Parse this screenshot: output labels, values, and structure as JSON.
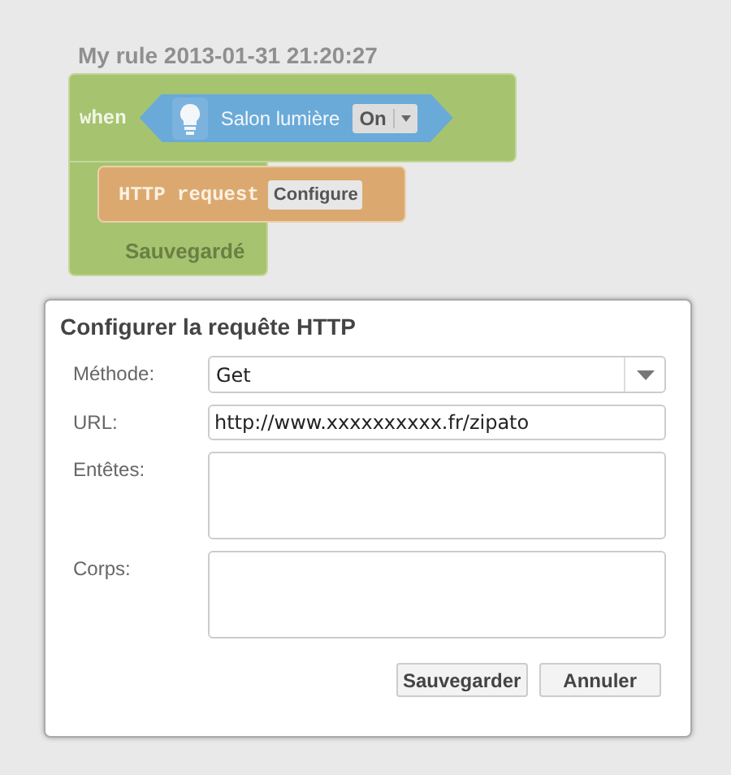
{
  "rule": {
    "title": "My rule 2013-01-31 21:20:27",
    "when_label": "when",
    "trigger": {
      "device": "Salon lumière",
      "state": "On"
    },
    "action": {
      "label": "HTTP request",
      "button": "Configure"
    },
    "status": "Sauvegardé"
  },
  "dialog": {
    "title": "Configurer la requête HTTP",
    "fields": [
      {
        "kind": "select",
        "label": "Méthode:",
        "value": "Get"
      },
      {
        "kind": "input",
        "label": "URL:",
        "value": "http://www.xxxxxxxxxx.fr/zipato"
      },
      {
        "kind": "textarea",
        "label": "Entêtes:"
      },
      {
        "kind": "textarea",
        "label": "Corps:"
      }
    ],
    "buttons": [
      "Sauvegarder",
      "Annuler"
    ]
  }
}
